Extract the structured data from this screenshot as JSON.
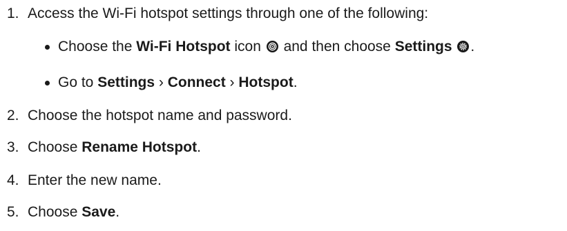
{
  "steps": [
    {
      "number": "1.",
      "text": "Access the Wi-Fi hotspot settings through one of the following:",
      "bullets": [
        {
          "parts": [
            {
              "t": "Choose the ",
              "b": false
            },
            {
              "t": "Wi-Fi Hotspot",
              "b": true
            },
            {
              "t": " icon ",
              "b": false
            },
            {
              "icon": "wifi-hotspot-icon"
            },
            {
              "t": " and then choose ",
              "b": false
            },
            {
              "t": "Settings",
              "b": true
            },
            {
              "t": " ",
              "b": false
            },
            {
              "icon": "settings-gear-icon"
            },
            {
              "t": ".",
              "b": false
            }
          ]
        },
        {
          "parts": [
            {
              "t": "Go to ",
              "b": false
            },
            {
              "t": "Settings",
              "b": true
            },
            {
              "t": " › ",
              "b": false
            },
            {
              "t": "Connect",
              "b": true
            },
            {
              "t": " › ",
              "b": false
            },
            {
              "t": "Hotspot",
              "b": true
            },
            {
              "t": ".",
              "b": false
            }
          ]
        }
      ]
    },
    {
      "number": "2.",
      "parts": [
        {
          "t": "Choose the hotspot name and password.",
          "b": false
        }
      ]
    },
    {
      "number": "3.",
      "parts": [
        {
          "t": "Choose ",
          "b": false
        },
        {
          "t": "Rename Hotspot",
          "b": true
        },
        {
          "t": ".",
          "b": false
        }
      ]
    },
    {
      "number": "4.",
      "parts": [
        {
          "t": "Enter the new name.",
          "b": false
        }
      ]
    },
    {
      "number": "5.",
      "parts": [
        {
          "t": "Choose ",
          "b": false
        },
        {
          "t": "Save",
          "b": true
        },
        {
          "t": ".",
          "b": false
        }
      ]
    }
  ]
}
